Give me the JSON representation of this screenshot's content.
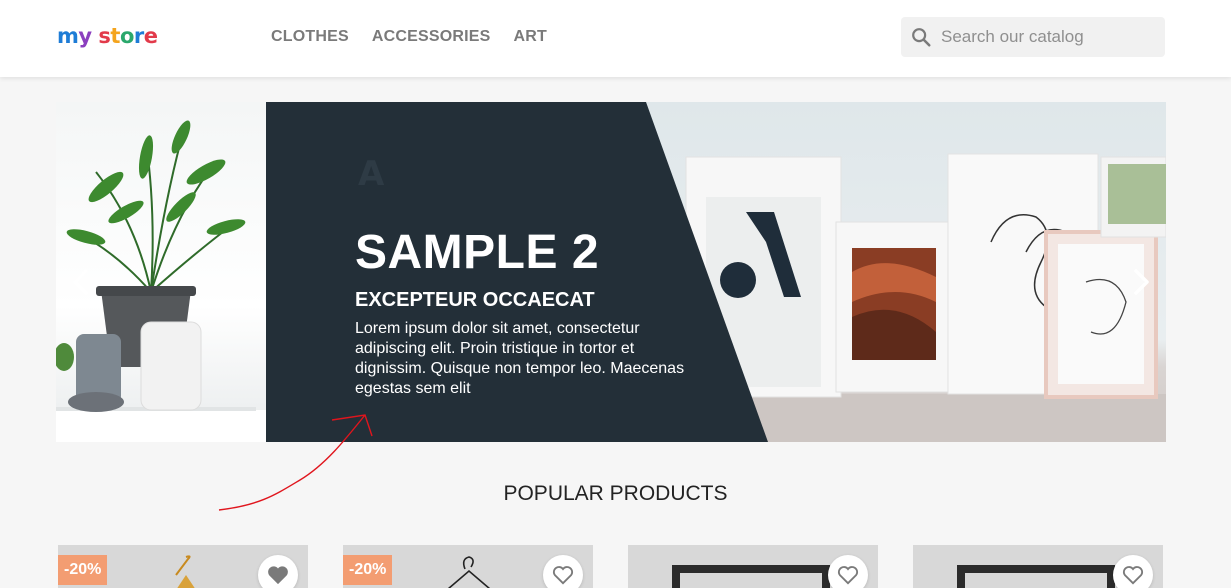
{
  "header": {
    "logo_letters": [
      "m",
      "y",
      " ",
      "s",
      "t",
      "o",
      "r",
      "e"
    ],
    "logo_colors": [
      "#1e7cd6",
      "#8b3fbf",
      "#ffffff",
      "#e23a4a",
      "#f4a41d",
      "#2aa86c",
      "#1e7cd6",
      "#e23a4a"
    ],
    "nav": [
      "CLOTHES",
      "ACCESSORIES",
      "ART"
    ],
    "search": {
      "placeholder": "Search our catalog",
      "icon": "search-icon"
    }
  },
  "carousel": {
    "title": "SAMPLE 2",
    "subtitle": "EXCEPTEUR OCCAECAT",
    "text": "Lorem ipsum dolor sit amet, consectetur adipiscing elit. Proin tristique in tortor et dignissim. Quisque non tempor leo. Maecenas egestas sem elit",
    "slide_logo": "A",
    "prev_icon": "chevron-left-icon",
    "next_icon": "chevron-right-icon",
    "dark_color": "#232f38"
  },
  "section": {
    "title": "POPULAR PRODUCTS"
  },
  "products": [
    {
      "badge": "-20%",
      "wishlist_icon": "heart-filled-icon"
    },
    {
      "badge": "-20%",
      "wishlist_icon": "heart-outline-icon"
    },
    {
      "badge": "",
      "wishlist_icon": "heart-outline-icon"
    },
    {
      "badge": "",
      "wishlist_icon": "heart-outline-icon"
    }
  ],
  "colors": {
    "badge": "#f39d72",
    "annotation": "#e0151d"
  }
}
